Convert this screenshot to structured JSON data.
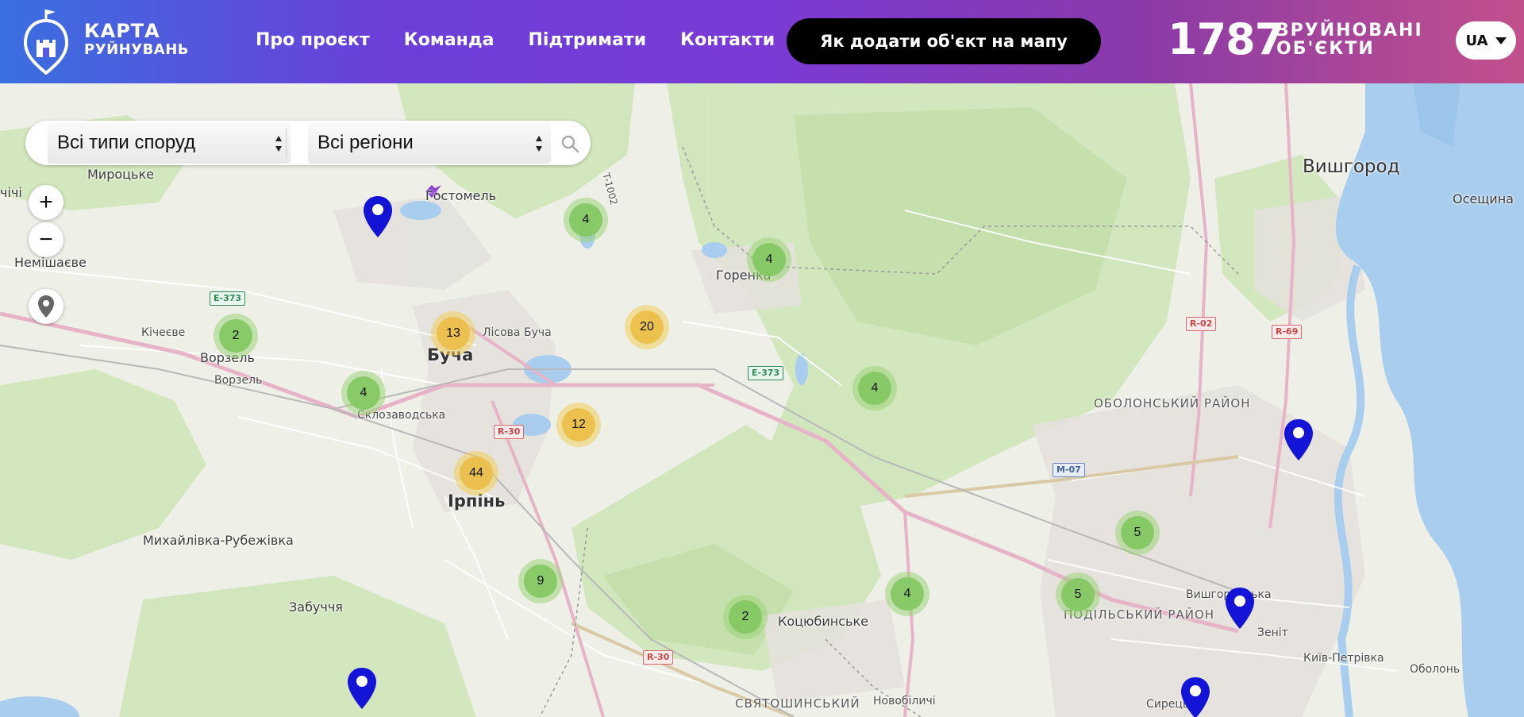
{
  "header": {
    "logo_line1": "КАРТА",
    "logo_line2": "РУЙНУВАНЬ",
    "nav": [
      "Про проєкт",
      "Команда",
      "Підтримати",
      "Контакти"
    ],
    "cta_label": "Як додати об'єкт на мапу",
    "counter_value": "1787",
    "counter_label_line1": "ЗРУЙНОВАНІ",
    "counter_label_line2": "ОБ'ЄКТИ",
    "language": "UA"
  },
  "filters": {
    "building_type": "Всі типи споруд",
    "region": "Всі регіони"
  },
  "controls": {
    "zoom_in": "+",
    "zoom_out": "−"
  },
  "places": {
    "myrotske": "Мироцьке",
    "hostomel": "Гостомель",
    "chi": "чічі",
    "nemishaieve": "Немішаєве",
    "horenka": "Горенка",
    "vyshhorod": "Вишгород",
    "oseshchyna": "Осещина",
    "kichieve": "Кічеєве",
    "vorzel_town": "Ворзель",
    "vorzel_station": "Ворзель",
    "lisova_bucha": "Лісова Буча",
    "bucha": "Буча",
    "sklozavodska": "Склозаводська",
    "irpin": "Ірпінь",
    "obolonskyi_district": "ОБОЛОНСЬКИЙ РАЙОН",
    "mykhailivka": "Михайлівка-Рубежівка",
    "zabuchchia": "Забуччя",
    "kotsiubynske": "Коцюбинське",
    "podilskyi_district": "ПОДІЛЬСЬКИЙ РАЙОН",
    "vyshhorodska": "Вишгородська",
    "zenit": "Зеніт",
    "kyiv_petrivka": "Київ-Петрівка",
    "obolon": "Оболонь",
    "syrets": "Сирець",
    "novobilychi": "Новобіличі",
    "sviatoshynskyi": "СВЯТОШИНСЬКИЙ"
  },
  "road_labels": {
    "e373_a": "E-373",
    "e373_b": "E-373",
    "r30_a": "R-30",
    "r30_b": "R-30",
    "r02": "R-02",
    "r69": "R-69",
    "m07": "M-07",
    "t1002": "T-1002"
  },
  "clusters": [
    {
      "count": "4",
      "color": "green"
    },
    {
      "count": "4",
      "color": "green"
    },
    {
      "count": "2",
      "color": "green"
    },
    {
      "count": "13",
      "color": "yellow"
    },
    {
      "count": "20",
      "color": "yellow"
    },
    {
      "count": "4",
      "color": "green"
    },
    {
      "count": "4",
      "color": "green"
    },
    {
      "count": "12",
      "color": "yellow"
    },
    {
      "count": "44",
      "color": "yellow"
    },
    {
      "count": "9",
      "color": "green"
    },
    {
      "count": "2",
      "color": "green"
    },
    {
      "count": "4",
      "color": "green"
    },
    {
      "count": "5",
      "color": "green"
    },
    {
      "count": "5",
      "color": "green"
    }
  ],
  "colors": {
    "pin": "#1414d6",
    "cluster_green": "#82c660",
    "cluster_yellow": "#ebbe46",
    "water": "#9ec9ec",
    "forest": "#c9e3b2"
  }
}
